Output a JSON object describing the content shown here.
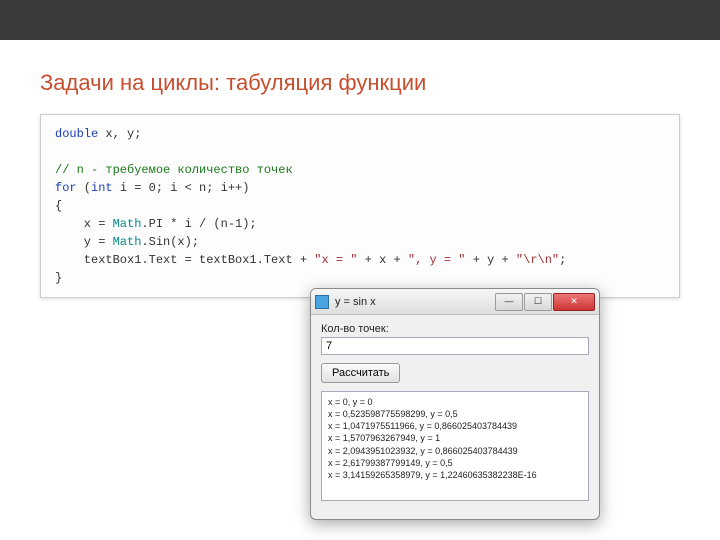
{
  "slide": {
    "title": "Задачи на циклы: табуляция функции"
  },
  "code": {
    "kw_double": "double",
    "decl_rest": " x, y;",
    "comment": "// n - требуемое количество точек",
    "kw_for": "for",
    "for_open": " (",
    "kw_int": "int",
    "for_cond": " i = 0; i < n; i++)",
    "brace_open": "{",
    "line_x_pre": "    x = ",
    "math1": "Math",
    "line_x_post": ".PI * i / (n-1);",
    "line_y_pre": "    y = ",
    "math2": "Math",
    "line_y_post": ".Sin(x);",
    "line_out_pre": "    textBox1.Text = textBox1.Text + ",
    "str1": "\"x = \"",
    "plus1": " + x + ",
    "str2": "\", y = \"",
    "plus2": " + y + ",
    "str3": "\"\\r\\n\"",
    "line_out_end": ";",
    "brace_close": "}"
  },
  "app": {
    "title": "y = sin x",
    "label_points": "Кол-во точек:",
    "points_value": "7",
    "button_calc": "Рассчитать",
    "output_lines": [
      "x = 0, y = 0",
      "x = 0,523598775598299, y = 0,5",
      "x = 1,0471975511966, y = 0,866025403784439",
      "x = 1,5707963267949, y = 1",
      "x = 2,0943951023932, y = 0,866025403784439",
      "x = 2,61799387799149, y = 0,5",
      "x = 3,14159265358979, y = 1,22460635382238E-16"
    ]
  },
  "winbuttons": {
    "min": "—",
    "max": "☐",
    "close": "✕"
  }
}
